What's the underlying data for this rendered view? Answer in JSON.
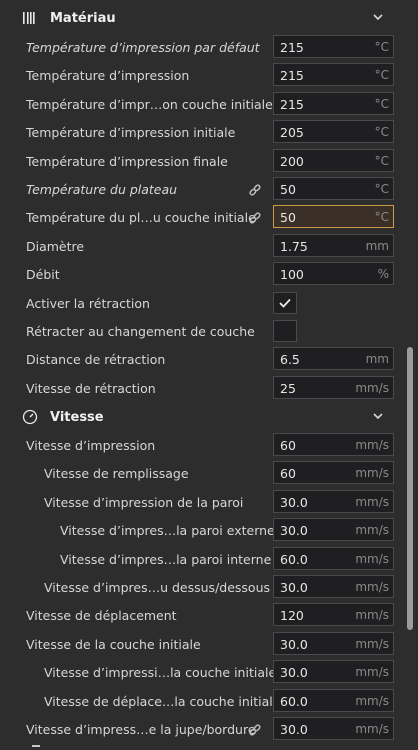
{
  "sections": {
    "material": {
      "title": "Matériau",
      "icon": "filament-icon"
    },
    "speed": {
      "title": "Vitesse",
      "icon": "speedometer-icon"
    }
  },
  "rows": [
    {
      "label": "Température d’impression par défaut",
      "italic": true,
      "value": "215",
      "unit": "°C",
      "indent": 0
    },
    {
      "label": "Température d’impression",
      "value": "215",
      "unit": "°C",
      "indent": 0
    },
    {
      "label": "Température d’impr…on couche initiale",
      "value": "215",
      "unit": "°C",
      "indent": 0
    },
    {
      "label": "Température d’impression initiale",
      "value": "205",
      "unit": "°C",
      "indent": 0
    },
    {
      "label": "Température d’impression finale",
      "value": "200",
      "unit": "°C",
      "indent": 0
    },
    {
      "label": "Température du plateau",
      "italic": true,
      "link": true,
      "value": "50",
      "unit": "°C",
      "indent": 0
    },
    {
      "label": "Température du pl…u couche initiale",
      "link": true,
      "active": true,
      "value": "50",
      "unit": "°C",
      "indent": 0
    },
    {
      "label": "Diamètre",
      "value": "1.75",
      "unit": "mm",
      "indent": 0
    },
    {
      "label": "Débit",
      "value": "100",
      "unit": "%",
      "indent": 0
    },
    {
      "label": "Activer la rétraction",
      "type": "checkbox",
      "checked": true,
      "indent": 0
    },
    {
      "label": "Rétracter au changement de couche",
      "type": "checkbox",
      "checked": false,
      "indent": 0
    },
    {
      "label": "Distance de rétraction",
      "value": "6.5",
      "unit": "mm",
      "indent": 0
    },
    {
      "label": "Vitesse de rétraction",
      "value": "25",
      "unit": "mm/s",
      "indent": 0
    },
    {
      "label": "Vitesse d’impression",
      "value": "60",
      "unit": "mm/s",
      "indent": 0
    },
    {
      "label": "Vitesse de remplissage",
      "value": "60",
      "unit": "mm/s",
      "indent": 1
    },
    {
      "label": "Vitesse d’impression de la paroi",
      "value": "30.0",
      "unit": "mm/s",
      "indent": 1
    },
    {
      "label": "Vitesse d’impres…la paroi externe",
      "value": "30.0",
      "unit": "mm/s",
      "indent": 2
    },
    {
      "label": "Vitesse d’impres…la paroi interne",
      "value": "60.0",
      "unit": "mm/s",
      "indent": 2
    },
    {
      "label": "Vitesse d’impres…u dessus/dessous",
      "value": "30.0",
      "unit": "mm/s",
      "indent": 1
    },
    {
      "label": "Vitesse de déplacement",
      "value": "120",
      "unit": "mm/s",
      "indent": 0
    },
    {
      "label": "Vitesse de la couche initiale",
      "value": "30.0",
      "unit": "mm/s",
      "indent": 0
    },
    {
      "label": "Vitesse d’impressi…la couche initiale",
      "value": "30.0",
      "unit": "mm/s",
      "indent": 1
    },
    {
      "label": "Vitesse de déplace…la couche initiale",
      "value": "60.0",
      "unit": "mm/s",
      "indent": 1
    },
    {
      "label": "Vitesse d’impress…e la jupe/bordure",
      "link": true,
      "value": "30.0",
      "unit": "mm/s",
      "indent": 0
    }
  ]
}
